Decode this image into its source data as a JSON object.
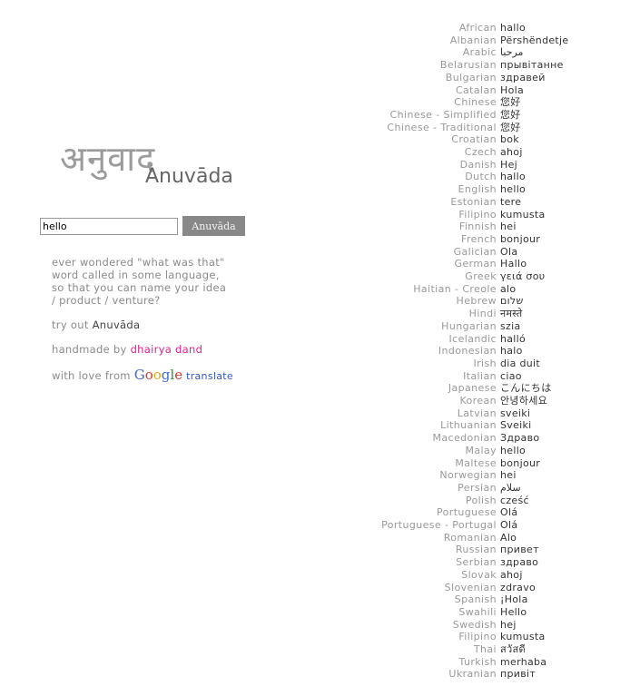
{
  "logo": {
    "devanagari": "अनुवाद",
    "latin": "Anuvāda"
  },
  "search": {
    "value": "hello",
    "button": "Anuvāda"
  },
  "description": "ever wondered \"what was that\" word called in some language, so that you can name your idea / product / venture?",
  "try": {
    "prefix": "try out ",
    "name": "Anuvāda"
  },
  "handmade": {
    "prefix": "handmade by ",
    "author": "dhairya dand"
  },
  "love": {
    "prefix": "with love from ",
    "brand": "Google",
    "suffix": "translate"
  },
  "translations": [
    {
      "lang": "African",
      "word": "hallo"
    },
    {
      "lang": "Albanian",
      "word": "Përshëndetje"
    },
    {
      "lang": "Arabic",
      "word": "مرحبا"
    },
    {
      "lang": "Belarusian",
      "word": "прывітанне"
    },
    {
      "lang": "Bulgarian",
      "word": "здравей"
    },
    {
      "lang": "Catalan",
      "word": "Hola"
    },
    {
      "lang": "Chinese",
      "word": "您好"
    },
    {
      "lang": "Chinese - Simplified",
      "word": "您好"
    },
    {
      "lang": "Chinese - Traditional",
      "word": "您好"
    },
    {
      "lang": "Croatian",
      "word": "bok"
    },
    {
      "lang": "Czech",
      "word": "ahoj"
    },
    {
      "lang": "Danish",
      "word": "Hej"
    },
    {
      "lang": "Dutch",
      "word": "hallo"
    },
    {
      "lang": "English",
      "word": "hello"
    },
    {
      "lang": "Estonian",
      "word": "tere"
    },
    {
      "lang": "Filipino",
      "word": "kumusta"
    },
    {
      "lang": "Finnish",
      "word": "hei"
    },
    {
      "lang": "French",
      "word": "bonjour"
    },
    {
      "lang": "Galician",
      "word": "Ola"
    },
    {
      "lang": "German",
      "word": "Hallo"
    },
    {
      "lang": "Greek",
      "word": "γειά σου"
    },
    {
      "lang": "Haitian - Creole",
      "word": "alo"
    },
    {
      "lang": "Hebrew",
      "word": "שלום"
    },
    {
      "lang": "Hindi",
      "word": "नमस्ते"
    },
    {
      "lang": "Hungarian",
      "word": "szia"
    },
    {
      "lang": "Icelandic",
      "word": "halló"
    },
    {
      "lang": "Indonesian",
      "word": "halo"
    },
    {
      "lang": "Irish",
      "word": "dia duit"
    },
    {
      "lang": "Italian",
      "word": "ciao"
    },
    {
      "lang": "Japanese",
      "word": "こんにちは"
    },
    {
      "lang": "Korean",
      "word": "안녕하세요"
    },
    {
      "lang": "Latvian",
      "word": "sveiki"
    },
    {
      "lang": "Lithuanian",
      "word": "Sveiki"
    },
    {
      "lang": "Macedonian",
      "word": "Здраво"
    },
    {
      "lang": "Malay",
      "word": "hello"
    },
    {
      "lang": "Maltese",
      "word": "bonjour"
    },
    {
      "lang": "Norwegian",
      "word": "hei"
    },
    {
      "lang": "Persian",
      "word": "سلام"
    },
    {
      "lang": "Polish",
      "word": "cześć"
    },
    {
      "lang": "Portuguese",
      "word": "Olá"
    },
    {
      "lang": "Portuguese - Portugal",
      "word": "Olá"
    },
    {
      "lang": "Romanian",
      "word": "Alo"
    },
    {
      "lang": "Russian",
      "word": "привет"
    },
    {
      "lang": "Serbian",
      "word": "здраво"
    },
    {
      "lang": "Slovak",
      "word": "ahoj"
    },
    {
      "lang": "Slovenian",
      "word": "zdravo"
    },
    {
      "lang": "Spanish",
      "word": "¡Hola"
    },
    {
      "lang": "Swahili",
      "word": "Hello"
    },
    {
      "lang": "Swedish",
      "word": "hej"
    },
    {
      "lang": "Filipino",
      "word": "kumusta"
    },
    {
      "lang": "Thai",
      "word": "สวัสดี"
    },
    {
      "lang": "Turkish",
      "word": "merhaba"
    },
    {
      "lang": "Ukranian",
      "word": "привіт"
    }
  ]
}
